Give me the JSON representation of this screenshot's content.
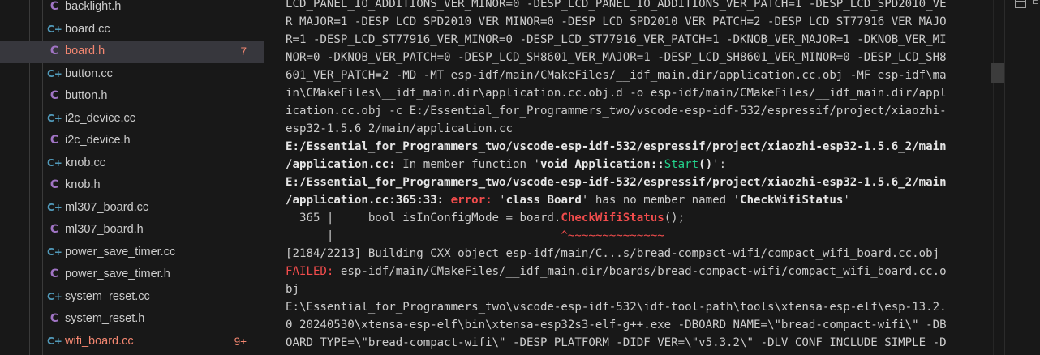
{
  "explorer": {
    "files": [
      {
        "label": "backlight.h",
        "icon": "c-header-icon",
        "badge": ""
      },
      {
        "label": "board.cc",
        "icon": "cpp-source-icon",
        "badge": ""
      },
      {
        "label": "board.h",
        "icon": "c-header-icon",
        "badge": "7"
      },
      {
        "label": "button.cc",
        "icon": "cpp-source-icon",
        "badge": ""
      },
      {
        "label": "button.h",
        "icon": "c-header-icon",
        "badge": ""
      },
      {
        "label": "i2c_device.cc",
        "icon": "cpp-source-icon",
        "badge": ""
      },
      {
        "label": "i2c_device.h",
        "icon": "c-header-icon",
        "badge": ""
      },
      {
        "label": "knob.cc",
        "icon": "cpp-source-icon",
        "badge": ""
      },
      {
        "label": "knob.h",
        "icon": "c-header-icon",
        "badge": ""
      },
      {
        "label": "ml307_board.cc",
        "icon": "cpp-source-icon",
        "badge": ""
      },
      {
        "label": "ml307_board.h",
        "icon": "c-header-icon",
        "badge": ""
      },
      {
        "label": "power_save_timer.cc",
        "icon": "cpp-source-icon",
        "badge": ""
      },
      {
        "label": "power_save_timer.h",
        "icon": "c-header-icon",
        "badge": ""
      },
      {
        "label": "system_reset.cc",
        "icon": "cpp-source-icon",
        "badge": ""
      },
      {
        "label": "system_reset.h",
        "icon": "c-header-icon",
        "badge": ""
      },
      {
        "label": "wifi_board.cc",
        "icon": "cpp-source-icon",
        "badge": "9+"
      }
    ],
    "selected_index": 2,
    "modified_indices": [
      2,
      15
    ]
  },
  "terminal": {
    "lines": [
      [
        {
          "t": "LCD_PANEL_IO_ADDITIONS_VER_MINOR=0 -DESP_LCD_PANEL_IO_ADDITIONS_VER_PATCH=1 -DESP_LCD_SPD2010_VE"
        }
      ],
      [
        {
          "t": "R_MAJOR=1 -DESP_LCD_SPD2010_VER_MINOR=0 -DESP_LCD_SPD2010_VER_PATCH=2 -DESP_LCD_ST77916_VER_MAJO"
        }
      ],
      [
        {
          "t": "R=1 -DESP_LCD_ST77916_VER_MINOR=0 -DESP_LCD_ST77916_VER_PATCH=1 -DKNOB_VER_MAJOR=1 -DKNOB_VER_MI"
        }
      ],
      [
        {
          "t": "NOR=0 -DKNOB_VER_PATCH=0 -DESP_LCD_SH8601_VER_MAJOR=1 -DESP_LCD_SH8601_VER_MINOR=0 -DESP_LCD_SH8"
        }
      ],
      [
        {
          "t": "601_VER_PATCH=2 -MD -MT esp-idf/main/CMakeFiles/__idf_main.dir/application.cc.obj -MF esp-idf\\ma"
        }
      ],
      [
        {
          "t": "in\\CMakeFiles\\__idf_main.dir\\application.cc.obj.d -o esp-idf/main/CMakeFiles/__idf_main.dir/appl"
        }
      ],
      [
        {
          "t": "ication.cc.obj -c E:/Essential_for_Programmers_two/vscode-esp-idf-532/espressif/project/xiaozhi-"
        }
      ],
      [
        {
          "t": "esp32-1.5.6_2/main/application.cc"
        }
      ],
      [
        {
          "t": "E:/Essential_for_Programmers_two/vscode-esp-idf-532/espressif/project/xiaozhi-esp32-1.5.6_2/main",
          "s": "bold"
        }
      ],
      [
        {
          "t": "/application.cc:",
          "s": "bold"
        },
        {
          "t": " In member function '"
        },
        {
          "t": "void Application::",
          "s": "bold"
        },
        {
          "t": "Start",
          "s": "green"
        },
        {
          "t": "()",
          "s": "bold"
        },
        {
          "t": "':"
        }
      ],
      [
        {
          "t": "E:/Essential_for_Programmers_two/vscode-esp-idf-532/espressif/project/xiaozhi-esp32-1.5.6_2/main",
          "s": "bold"
        }
      ],
      [
        {
          "t": "/application.cc:365:33: ",
          "s": "bold"
        },
        {
          "t": "error: ",
          "s": "redbold"
        },
        {
          "t": "'"
        },
        {
          "t": "class Board",
          "s": "bold"
        },
        {
          "t": "' has no member named '"
        },
        {
          "t": "CheckWifiStatus",
          "s": "bold"
        },
        {
          "t": "'"
        }
      ],
      [
        {
          "t": "  365 |     bool isInConfigMode = board."
        },
        {
          "t": "CheckWifiStatus",
          "s": "redbold"
        },
        {
          "t": "();"
        }
      ],
      [
        {
          "t": "      |                                 "
        },
        {
          "t": "^~~~~~~~~~~~~~~",
          "s": "red"
        }
      ],
      [
        {
          "t": "[2184/2213] Building CXX object esp-idf/main/C...s/bread-compact-wifi/compact_wifi_board.cc.obj"
        }
      ],
      [
        {
          "t": "FAILED:",
          "s": "red"
        },
        {
          "t": " esp-idf/main/CMakeFiles/__idf_main.dir/boards/bread-compact-wifi/compact_wifi_board.cc.o"
        }
      ],
      [
        {
          "t": "bj"
        }
      ],
      [
        {
          "t": "E:\\Essential_for_Programmers_two\\vscode-esp-idf-532\\idf-tool-path\\tools\\xtensa-esp-elf\\esp-13.2."
        }
      ],
      [
        {
          "t": "0_20240530\\xtensa-esp-elf\\bin\\xtensa-esp32s3-elf-g++.exe -DBOARD_NAME=\\\"bread-compact-wifi\\\" -DB"
        }
      ],
      [
        {
          "t": "OARD_TYPE=\\\"bread-compact-wifi\\\" -DESP_PLATFORM -DIDF_VER=\\\"v5.3.2\\\" -DLV_CONF_INCLUDE_SIMPLE -D"
        }
      ]
    ]
  },
  "right_panel": {
    "icon": "terminal-panel-icon",
    "label": "E"
  }
}
